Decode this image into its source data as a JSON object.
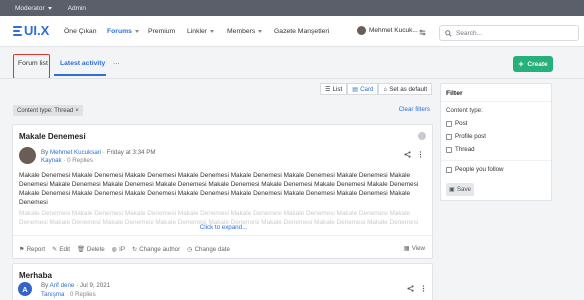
{
  "modbar": {
    "items": [
      {
        "label": "Moderator"
      },
      {
        "label": "Admin"
      }
    ]
  },
  "brand": {
    "logo_text": "UI.X",
    "accent": "#2f6fd8",
    "create_color": "#26b07a",
    "highlight_color": "#e23232"
  },
  "nav": {
    "items": [
      {
        "label": "Öne Çıkan"
      },
      {
        "label": "Forums"
      },
      {
        "label": "Premium"
      },
      {
        "label": "Linkler"
      },
      {
        "label": "Members"
      },
      {
        "label": "Gazete Manşetleri"
      }
    ],
    "user_name": "Mehmet Kucuk...",
    "search_placeholder": "Search..."
  },
  "tabs": {
    "forum_list": "Forum list",
    "latest_activity": "Latest activity",
    "more": "···",
    "create": "Create"
  },
  "viewbar": {
    "list": "List",
    "card": "Card",
    "default": "Set as default"
  },
  "filters": {
    "chip": "Content type: Thread",
    "clear": "Clear filters"
  },
  "threads": [
    {
      "title": "Makale Denemesi",
      "author": "Mehmet Kucuksari",
      "time": "Friday at 3:34 PM",
      "forum": "Kaynak",
      "replies": "0 Replies",
      "body": "Makale Denemesi Makale Denemesi Makale Denemesi Makale Denemesi Makale Denemesi Makale Denemesi Makale Denemesi Makale Denemesi Makale Denemesi Makale Denemesi Makale Denemesi Makale Denemesi Makale Denemesi Makale Denemesi Makale Denemesi Makale Denemesi Makale Denemesi Makale Denemesi Makale Denemesi Makale Denemesi Makale Denemesi Makale Denemesi Makale Denemesi",
      "body_fade": "Makale Denemesi Makale Denemesi Makale Denemesi Makale Denemesi Makale Denemesi Makale Denemesi Makale Denemesi Makale Denemesi Makale Denemesi Makale Denemesi Makale Denemesi Makale Denemesi Makale Denemesi Makale Denemesi Makale Denemesi",
      "expand": "Click to expand...",
      "actions": {
        "report": "Report",
        "edit": "Edit",
        "delete": "Delete",
        "ip": "IP",
        "change_author": "Change author",
        "change_date": "Change date",
        "view": "View"
      }
    },
    {
      "title": "Merhaba",
      "author": "Arif dene",
      "time": "Jul 9, 2021",
      "forum": "Tanışma",
      "replies": "0 Replies",
      "avatar_letter": "A"
    }
  ],
  "filter_panel": {
    "heading": "Filter",
    "content_type_label": "Content type:",
    "options": [
      "Post",
      "Profile post",
      "Thread"
    ],
    "people": "People you follow",
    "save": "Save"
  }
}
